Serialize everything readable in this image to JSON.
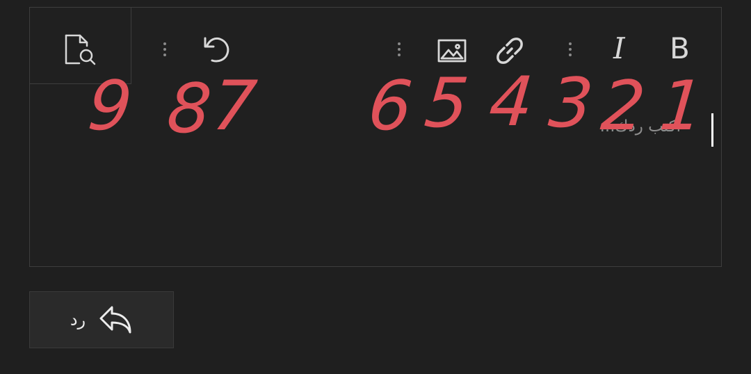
{
  "toolbar": {
    "bold_label": "B",
    "italic_label": "I",
    "link_icon": "link-icon",
    "image_icon": "image-icon",
    "undo_icon": "undo-icon",
    "preview_icon": "preview-search-icon",
    "more_icon": "more-vertical-icon"
  },
  "editor": {
    "placeholder": "اكتب ردك..."
  },
  "annotations": [
    "1",
    "2",
    "3",
    "4",
    "5",
    "6",
    "7",
    "8",
    "9"
  ],
  "reply": {
    "label": "رد",
    "icon": "reply-arrow-icon"
  },
  "colors": {
    "background": "#1f1f1f",
    "border": "#3e3e3e",
    "icon": "#d8d8d8",
    "annotation": "#e0525a",
    "button": "#2a2a2a"
  }
}
